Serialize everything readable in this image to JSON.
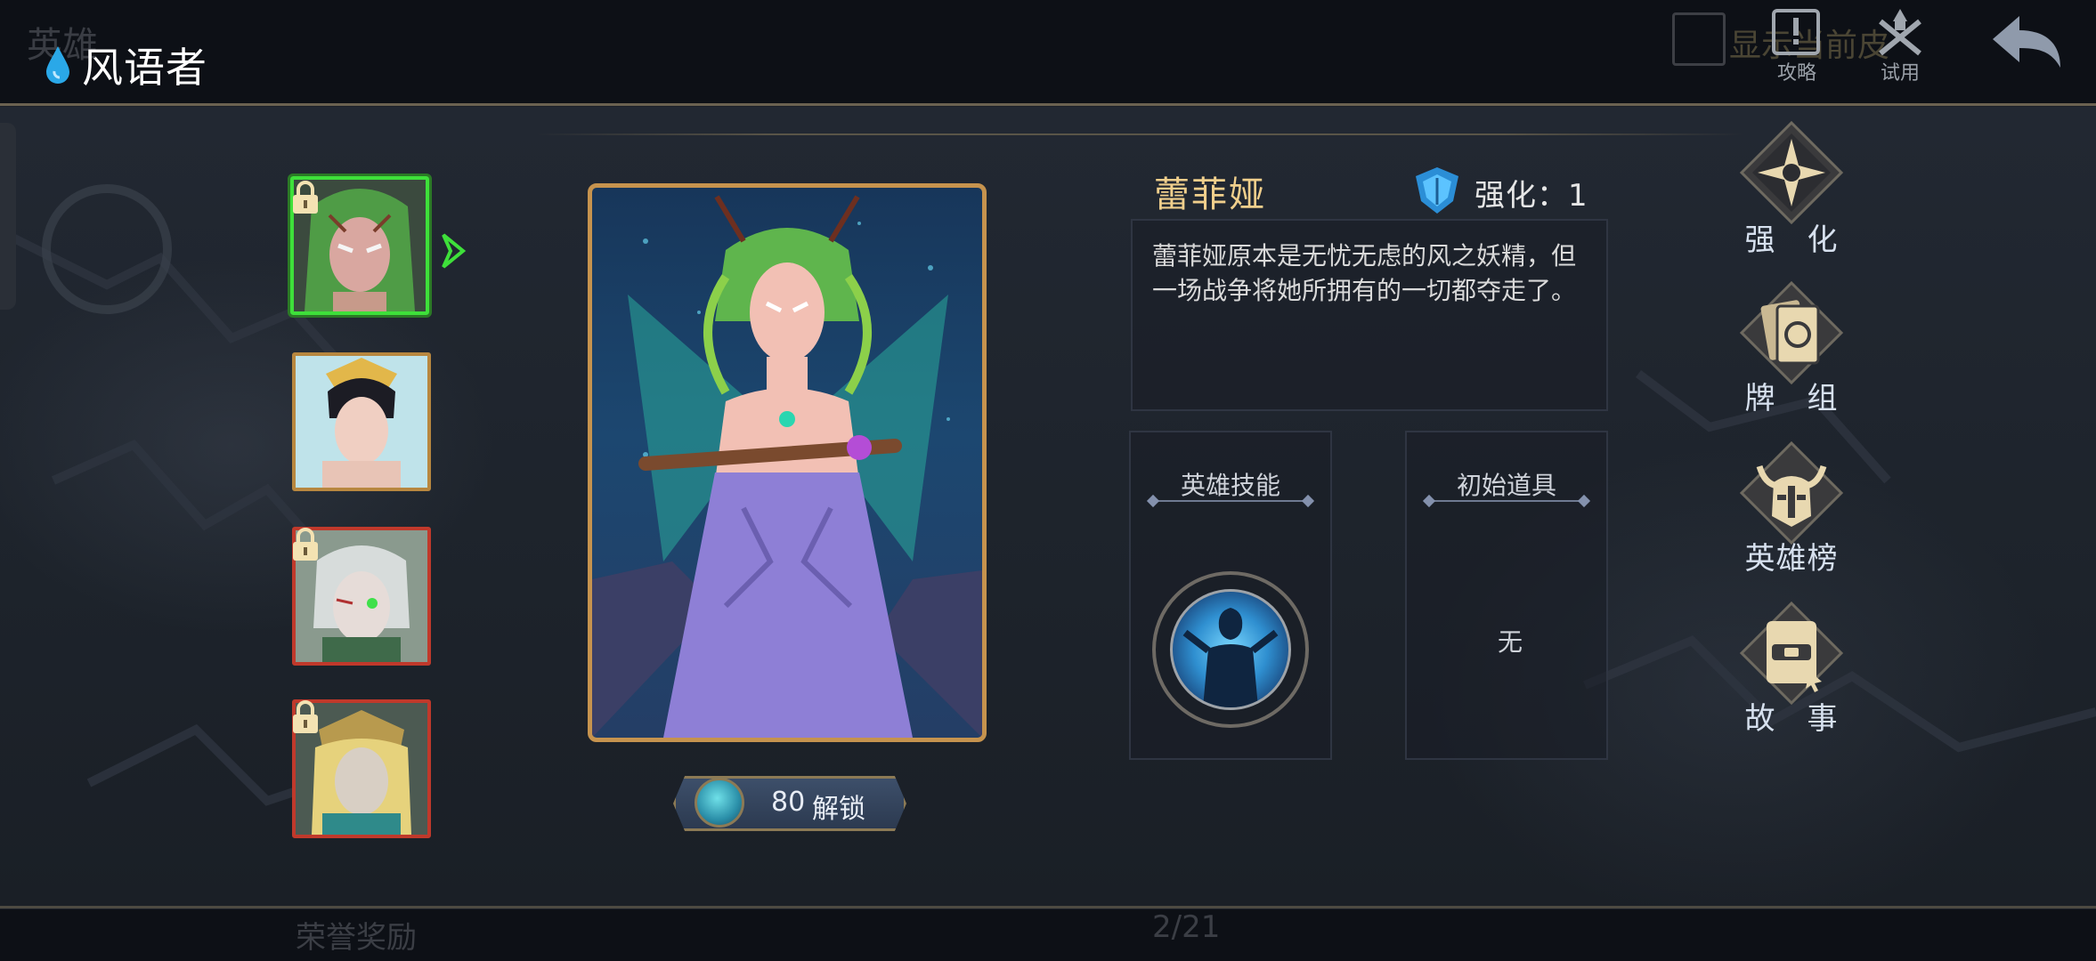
{
  "header": {
    "title": "风语者",
    "ghost_tab": "英雄",
    "ghost_checkbox_label": "显示当前皮",
    "strategy_label": "攻略",
    "trial_label": "试用"
  },
  "heroes": [
    {
      "name": "蕾菲娅",
      "locked": true,
      "selected": true
    },
    {
      "name": "",
      "locked": false,
      "selected": false
    },
    {
      "name": "",
      "locked": true,
      "selected": false
    },
    {
      "name": "",
      "locked": true,
      "selected": false
    }
  ],
  "hero": {
    "name": "蕾菲娅",
    "enhance_label": "强化：1",
    "description": "蕾菲娅原本是无忧无虑的风之妖精，但一场战争将她所拥有的一切都夺走了。",
    "skill_title": "英雄技能",
    "item_title": "初始道具",
    "item_value": "无"
  },
  "unlock": {
    "cost": "80",
    "label": "解锁"
  },
  "menu": [
    {
      "label": "强　化",
      "icon": "compass-star-icon"
    },
    {
      "label": "牌　组",
      "icon": "card-deck-icon"
    },
    {
      "label": "英雄榜",
      "icon": "horned-helmet-icon"
    },
    {
      "label": "故　事",
      "icon": "book-icon"
    }
  ],
  "footer": {
    "ghost_reward": "荣誉奖励",
    "page_indicator": "2/21"
  },
  "colors": {
    "accent_gold": "#c6934e",
    "selected_green": "#3ee03a",
    "locked_red": "#c0392b",
    "name_gold": "#f0cf8c"
  }
}
